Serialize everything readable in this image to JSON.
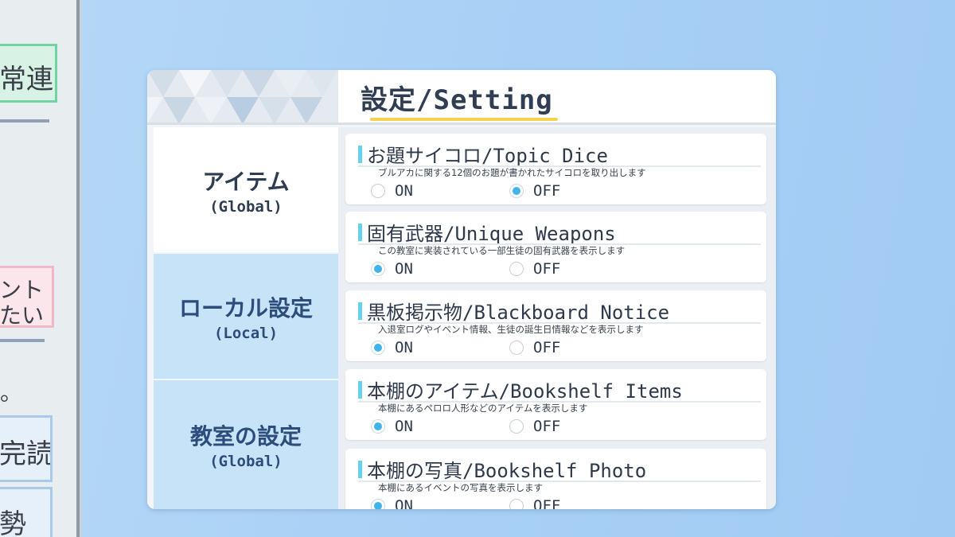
{
  "background": {
    "tags": [
      "常連",
      "ント",
      "たい",
      "。",
      "完読",
      "勢"
    ]
  },
  "header": {
    "title": "設定/Setting"
  },
  "tabs": [
    {
      "name": "アイテム",
      "scope": "(Global)",
      "active": true
    },
    {
      "name": "ローカル設定",
      "scope": "(Local)",
      "active": false
    },
    {
      "name": "教室の設定",
      "scope": "(Global)",
      "active": false
    }
  ],
  "settings": [
    {
      "title": "お題サイコロ/Topic Dice",
      "desc": "ブルアカに関する12個のお題が書かれたサイコロを取り出します",
      "on_label": "ON",
      "off_label": "OFF",
      "selected": "OFF"
    },
    {
      "title": "固有武器/Unique Weapons",
      "desc": "この教室に実装されている一部生徒の固有武器を表示します",
      "on_label": "ON",
      "off_label": "OFF",
      "selected": "ON"
    },
    {
      "title": "黒板掲示物/Blackboard Notice",
      "desc": "入退室ログやイベント情報、生徒の誕生日情報などを表示します",
      "on_label": "ON",
      "off_label": "OFF",
      "selected": "ON"
    },
    {
      "title": "本棚のアイテム/Bookshelf Items",
      "desc": "本棚にあるペロロ人形などのアイテムを表示します",
      "on_label": "ON",
      "off_label": "OFF",
      "selected": "ON"
    },
    {
      "title": "本棚の写真/Bookshelf Photo",
      "desc": "本棚にあるイベントの写真を表示します",
      "on_label": "ON",
      "off_label": "OFF",
      "selected": "ON"
    }
  ],
  "colors": {
    "accent": "#3fb3ea",
    "title_underline": "#f3d250",
    "tab_inactive": "#c6e3f8",
    "card_bar": "#63d2ea"
  }
}
